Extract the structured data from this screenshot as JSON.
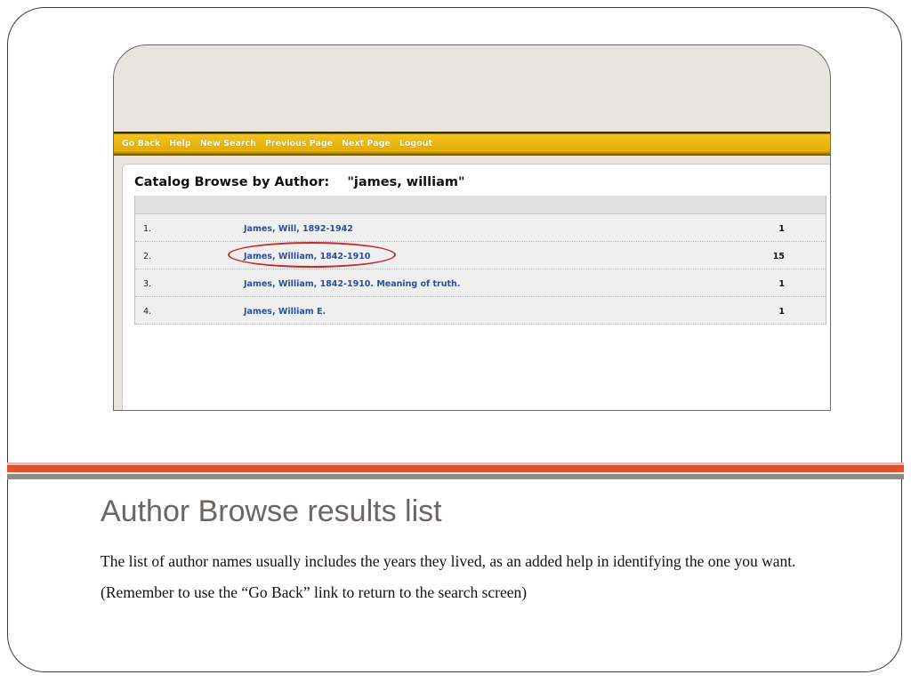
{
  "screenshot": {
    "navbar": [
      "Go Back",
      "Help",
      "New Search",
      "Previous Page",
      "Next Page",
      "Logout"
    ],
    "panel_title": "Catalog Browse by Author:    \"james, william\"",
    "rows": [
      {
        "num": "1.",
        "author": "James, Will, 1892-1942",
        "count": "1"
      },
      {
        "num": "2.",
        "author": "James, William, 1842-1910",
        "count": "15"
      },
      {
        "num": "3.",
        "author": "James, William, 1842-1910. Meaning of truth.",
        "count": "1"
      },
      {
        "num": "4.",
        "author": "James, William E.",
        "count": "1"
      }
    ],
    "highlighted_row": 2
  },
  "slide": {
    "title": "Author Browse results list",
    "paragraph1": "The list of author names usually includes the years they lived, as an added help in identifying the one you want.",
    "paragraph2": "(Remember to use the “Go Back” link to return to the search screen)"
  },
  "colors": {
    "accent_orange": "#e0522a",
    "accent_grey": "#8c8c8c",
    "nav_yellow": "#e8b30c",
    "link_blue": "#2a4f9c",
    "highlight_red": "#c62828"
  }
}
